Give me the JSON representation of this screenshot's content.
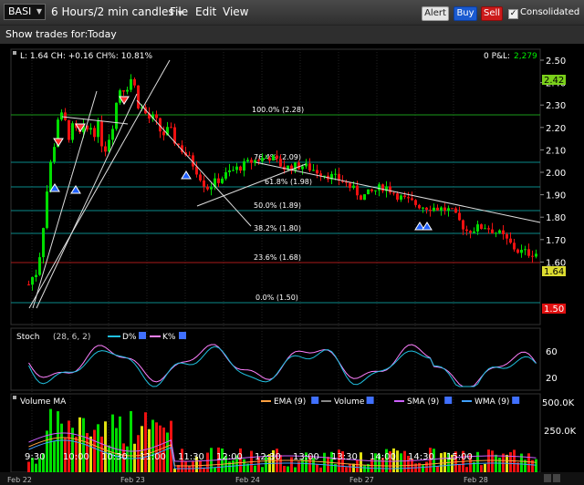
{
  "toolbar": {
    "symbol": "BASI",
    "period": "6 Hours/2 min candles",
    "menu": [
      "File",
      "Edit",
      "View"
    ],
    "alert_label": "Alert",
    "buy_label": "Buy",
    "sell_label": "Sell",
    "consolidated_label": "Consolidated"
  },
  "subbar": {
    "label": "Show trades for:",
    "value": "Today"
  },
  "price_panel": {
    "info": "L: 1.64 CH: +0.16 CH%: 10.81%",
    "pnl_label": "0 P&L:",
    "pnl_value": "2,279",
    "axis_ticks": [
      "2.50",
      "2.40",
      "2.30",
      "2.20",
      "2.10",
      "2.00",
      "1.90",
      "1.80",
      "1.70",
      "1.60"
    ],
    "last_price": "1.64",
    "high_tag": "2.42",
    "low_tag": "1.50",
    "fib_levels": [
      "100.0% (2.28)",
      "76.4% (2.09)",
      "61.8% (1.98)",
      "50.0% (1.89)",
      "38.2% (1.80)",
      "23.6% (1.68)",
      "0.0% (1.50)"
    ]
  },
  "stoch_panel": {
    "title": "Stoch",
    "params": "(28, 6, 2)",
    "d_label": "D%",
    "k_label": "K%",
    "axis_ticks": [
      "60",
      "20"
    ]
  },
  "volume_panel": {
    "title": "Volume MA",
    "legend": [
      "EMA (9)",
      "Volume",
      "SMA (9)",
      "WMA (9)"
    ],
    "axis_ticks": [
      "500.0K",
      "250.0K"
    ]
  },
  "time_axis": {
    "ticks": [
      "9:30",
      "10:00",
      "10:30",
      "11:00",
      "11:30",
      "12:00",
      "12:30",
      "13:00",
      "13:30",
      "14:00",
      "14:30",
      "15:00"
    ],
    "dates": [
      "Feb 22",
      "Feb 23",
      "Feb 24",
      "Feb 27",
      "Feb 28"
    ]
  },
  "colors": {
    "up": "#00dd00",
    "down": "#ee1111",
    "fib": "#0a8a8a",
    "trend": "#dddddd"
  }
}
